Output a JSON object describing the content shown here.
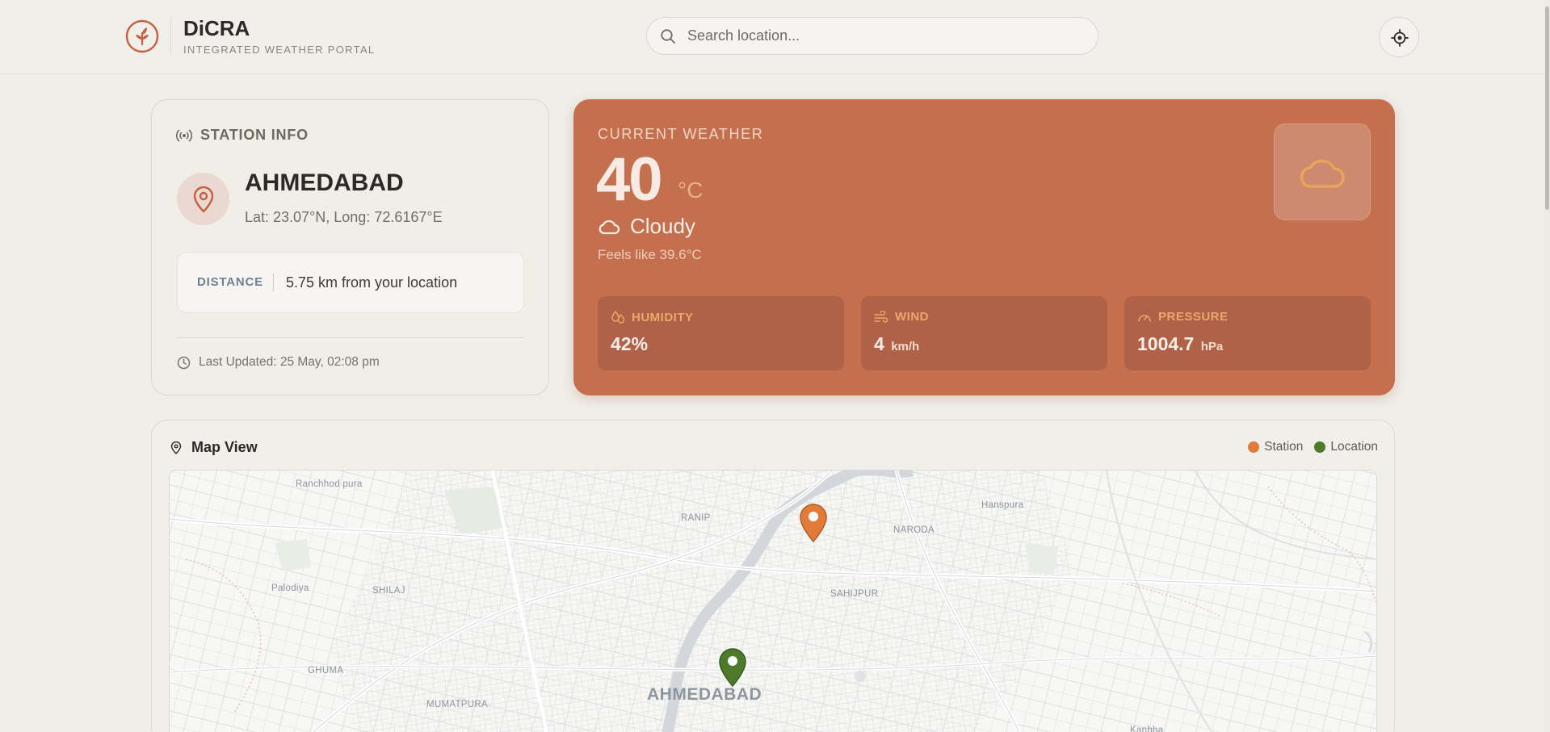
{
  "header": {
    "brand_title": "DiCRA",
    "brand_subtitle": "INTEGRATED WEATHER PORTAL",
    "search_placeholder": "Search location...",
    "search_value": ""
  },
  "station": {
    "heading": "STATION INFO",
    "name": "AHMEDABAD",
    "coords": "Lat: 23.07°N, Long: 72.6167°E",
    "distance_label": "DISTANCE",
    "distance_value": "5.75 km from your location",
    "last_updated": "Last Updated: 25 May, 02:08 pm"
  },
  "weather": {
    "heading": "CURRENT WEATHER",
    "temperature": "40",
    "unit": "°C",
    "condition": "Cloudy",
    "feels_like": "Feels like 39.6°C",
    "stats": [
      {
        "label": "HUMIDITY",
        "value": "42%",
        "unit": ""
      },
      {
        "label": "WIND",
        "value": "4",
        "unit": "km/h"
      },
      {
        "label": "PRESSURE",
        "value": "1004.7",
        "unit": "hPa"
      }
    ]
  },
  "map": {
    "title": "Map View",
    "legend": [
      {
        "label": "Station",
        "color": "#e07b39"
      },
      {
        "label": "Location",
        "color": "#4e7a2c"
      }
    ],
    "places": {
      "ranchhod_pura": "Ranchhod pura",
      "ranip": "RANIP",
      "hanspura": "Hanspura",
      "naroda": "NARODA",
      "palodiya": "Palodiya",
      "shilaj": "SHILAJ",
      "sahijpur": "SAHIJPUR",
      "ghuma": "GHUMA",
      "mumatpura": "MUMATPURA",
      "ahmedabad": "AHMEDABAD",
      "kanbha": "Kanbha"
    }
  },
  "colors": {
    "accent": "#c4704f",
    "station_marker": "#e07b39",
    "location_marker": "#4e7a2c"
  }
}
